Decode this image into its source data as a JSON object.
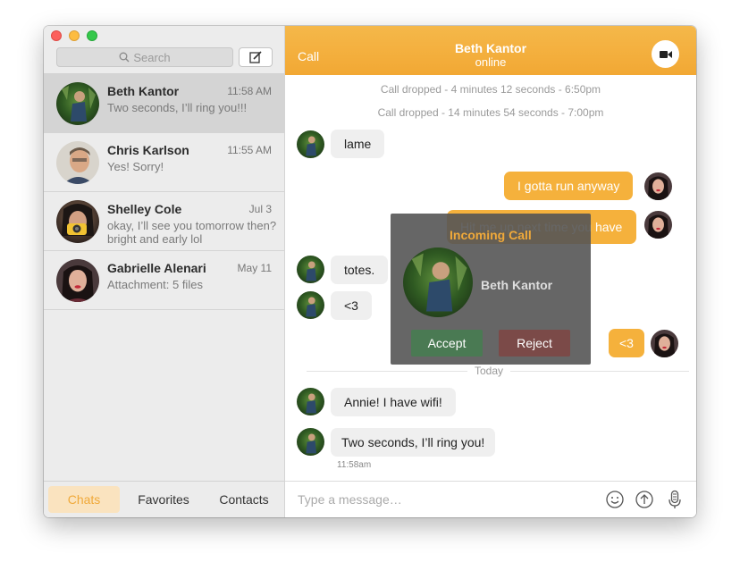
{
  "sidebar": {
    "search_placeholder": "Search",
    "chats": [
      {
        "name": "Beth Kantor",
        "time": "11:58 AM",
        "message": "Two seconds, I’ll ring you!!!",
        "avatar": "beth-avatar"
      },
      {
        "name": "Chris Karlson",
        "time": "11:55 AM",
        "message": "Yes! Sorry!",
        "avatar": "chris-avatar"
      },
      {
        "name": "Shelley Cole",
        "time": "Jul 3",
        "message": "okay, I’ll see you tomorrow then? bright and early lol",
        "avatar": "shelley-avatar"
      },
      {
        "name": "Gabrielle Alenari",
        "time": "May 11",
        "message": "Attachment: 5 files",
        "avatar": "gabrielle-avatar"
      }
    ],
    "tabs": {
      "chats": "Chats",
      "favorites": "Favorites",
      "contacts": "Contacts"
    }
  },
  "header": {
    "call_label": "Call",
    "name": "Beth Kantor",
    "status": "online"
  },
  "conversation": {
    "system": [
      "Call dropped - 4 minutes 12 seconds - 6:50pm",
      "Call dropped - 14 minutes 54 seconds - 7:00pm"
    ],
    "messages": {
      "lame": "lame",
      "gotta_run": "I gotta run anyway",
      "hit_me_up": "Hit me up next time you have",
      "totes": "totes.",
      "heart_in": "<3",
      "heart_out": "<3",
      "annie": "Annie! I have wifi!",
      "two_seconds": "Two seconds, I’ll ring you!"
    },
    "divider": "Today",
    "timestamp": "11:58am"
  },
  "composer": {
    "placeholder": "Type a message…"
  },
  "incoming_call": {
    "title": "Incoming Call",
    "caller": "Beth Kantor",
    "accept": "Accept",
    "reject": "Reject"
  },
  "colors": {
    "accent": "#f2a834",
    "accept": "#4a7a53",
    "reject": "#7b4a48"
  }
}
